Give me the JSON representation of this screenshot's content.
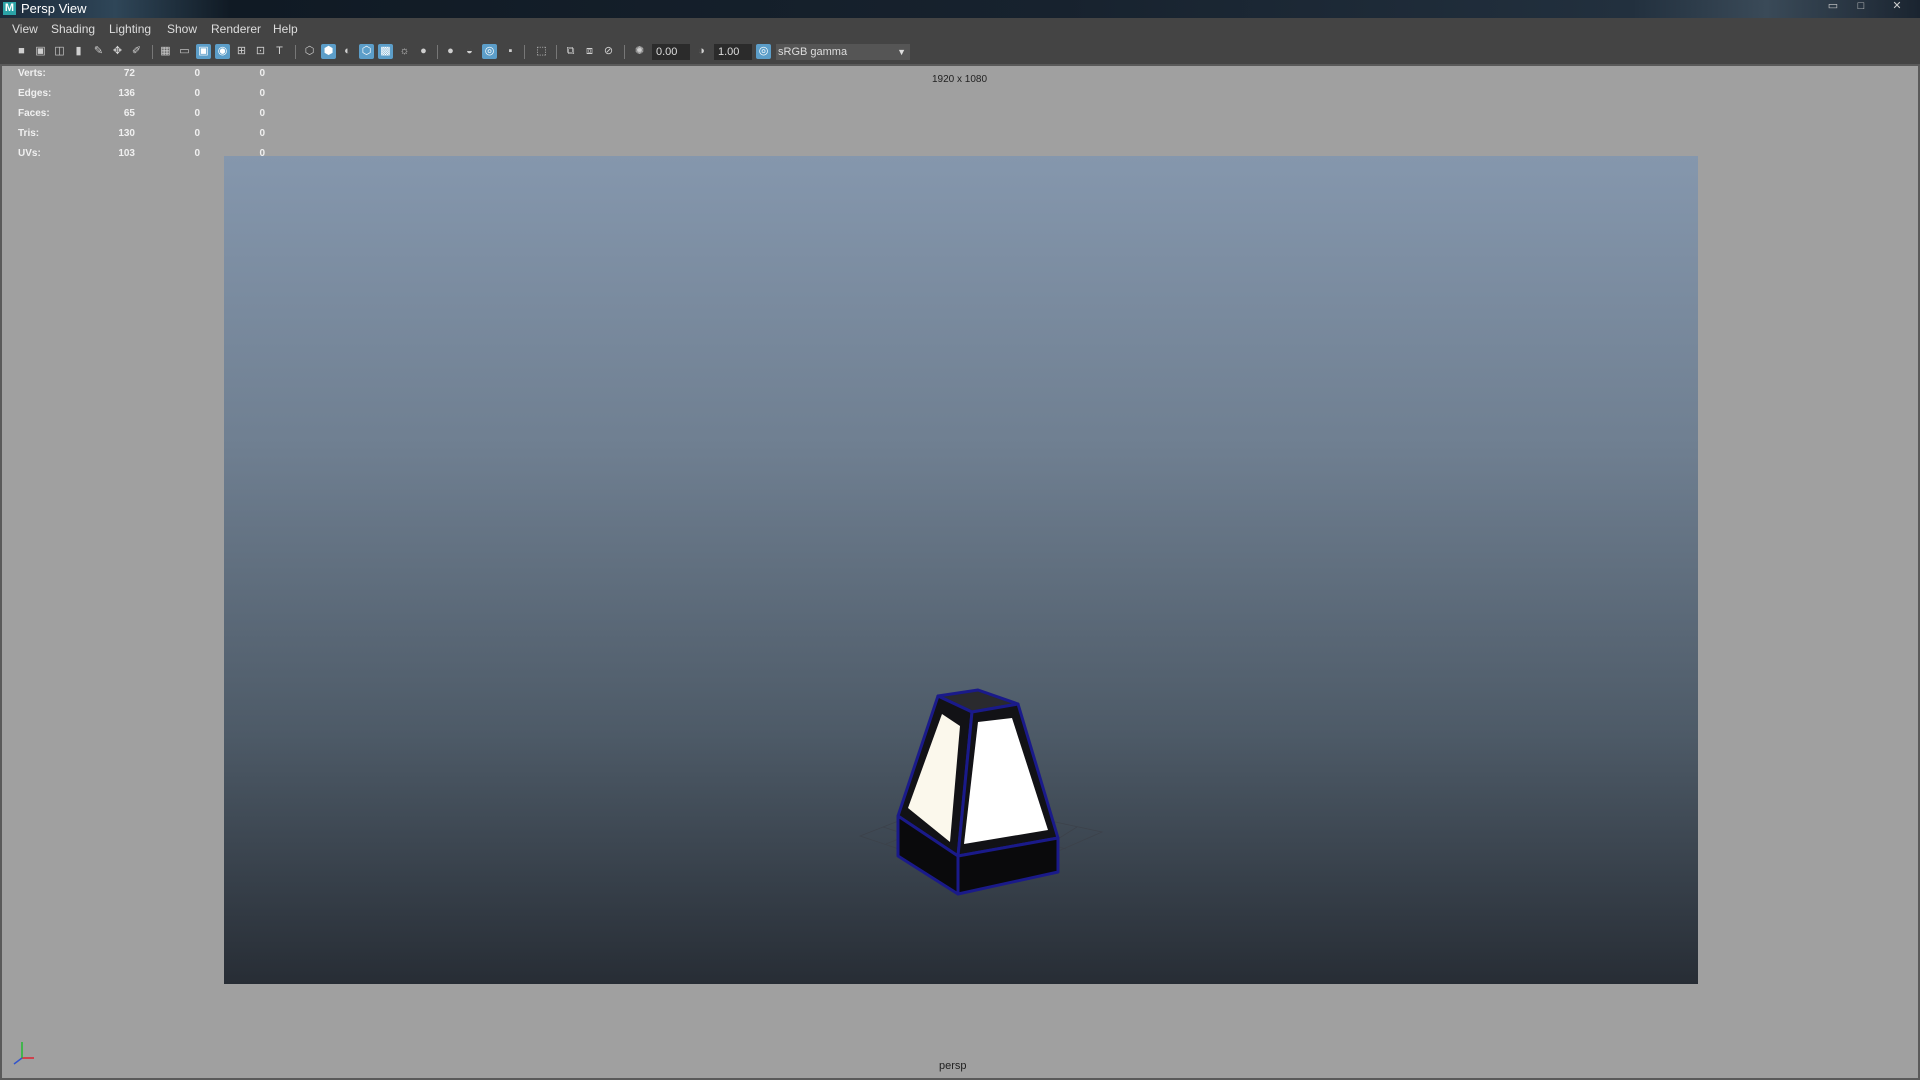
{
  "window": {
    "app_icon": "M",
    "title": "Persp View",
    "controls": {
      "minimize": "▭",
      "maximize": "□",
      "close": "✕"
    }
  },
  "menu": [
    "View",
    "Shading",
    "Lighting",
    "Show",
    "Renderer",
    "Help"
  ],
  "toolbar": {
    "exposure": "0.00",
    "gamma": "1.00",
    "color_space": "sRGB gamma",
    "icons": [
      "camera-icon",
      "camera-attributes-icon",
      "bookmark-icon",
      "image-plane-icon",
      "grid-icon",
      "film-gate-icon",
      "resolution-gate-icon",
      "gate-mask-icon",
      "field-chart-icon",
      "safe-action-icon",
      "safe-title-icon",
      "wireframe-icon",
      "smooth-shade-icon",
      "default-material-icon",
      "wireframe-on-shaded-icon",
      "textured-icon",
      "lights-icon",
      "shadows-icon",
      "screen-space-ao-icon",
      "motion-blur-icon",
      "anti-aliasing-icon",
      "depth-of-field-icon",
      "isolate-select-icon",
      "xray-icon",
      "xray-joints-icon",
      "xray-components-icon",
      "exposure-icon",
      "gamma-icon",
      "color-management-icon"
    ]
  },
  "hud": {
    "rows": [
      {
        "label": "Verts:",
        "values": [
          "72",
          "0",
          "0"
        ]
      },
      {
        "label": "Edges:",
        "values": [
          "136",
          "0",
          "0"
        ]
      },
      {
        "label": "Faces:",
        "values": [
          "65",
          "0",
          "0"
        ]
      },
      {
        "label": "Tris:",
        "values": [
          "130",
          "0",
          "0"
        ]
      },
      {
        "label": "UVs:",
        "values": [
          "103",
          "0",
          "0"
        ]
      }
    ],
    "resolution": "1920 x 1080",
    "camera": "persp"
  },
  "colors": {
    "viewport_bg": "#a0a0a0",
    "gradient_top": "#8597ad",
    "gradient_bottom": "#272d35",
    "selection_highlight": "#1a1a8a",
    "accent": "#5c9ec9"
  }
}
